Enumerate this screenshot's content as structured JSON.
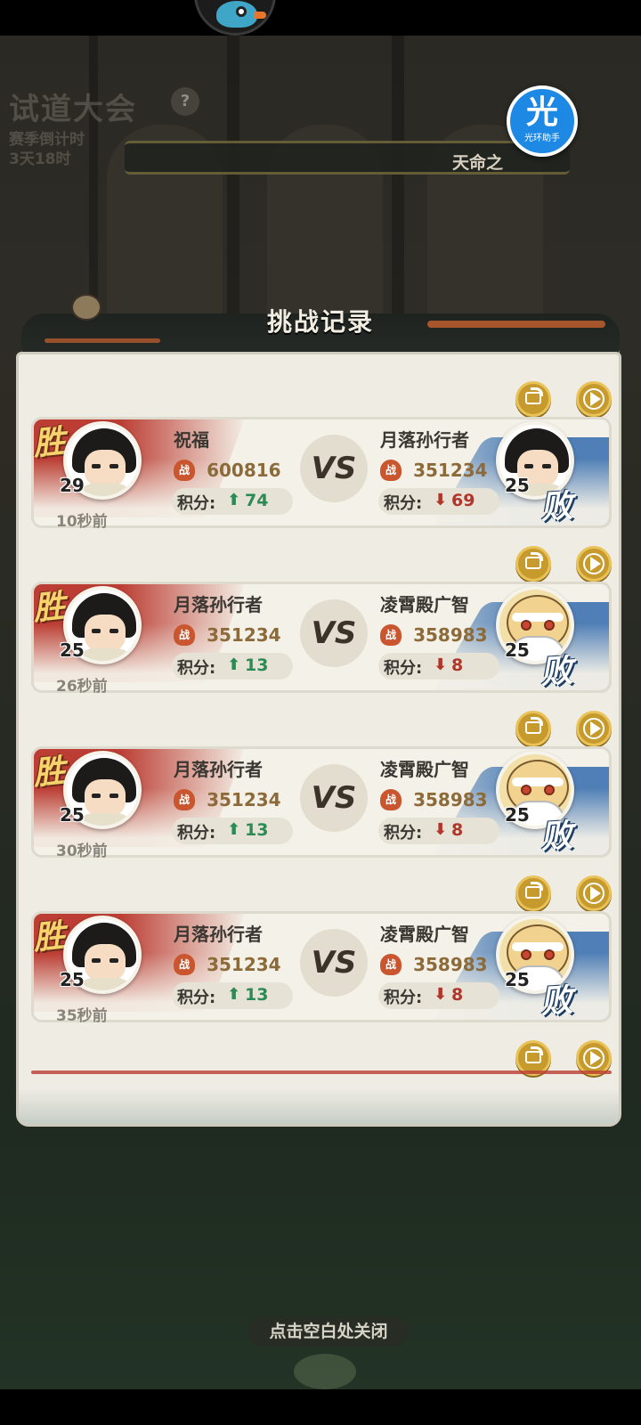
{
  "background": {
    "event_title": "试道大会",
    "help_glyph": "?",
    "season_line1": "赛季倒计时",
    "season_line2": "3天18时",
    "strip_text": "天命之"
  },
  "helper_badge": {
    "glyph": "光",
    "label": "光环助手"
  },
  "panel": {
    "title": "挑战记录"
  },
  "labels": {
    "vs": "VS",
    "score_label": "积分:",
    "win": "胜",
    "lose": "败",
    "power_icon_glyph": "战"
  },
  "colors": {
    "win": "#bb3d33",
    "lose": "#4f7fb6",
    "up": "#2c8a55",
    "down": "#b2352a",
    "gold": "#c79a2e"
  },
  "records": [
    {
      "time": "10秒前",
      "left": {
        "name": "祝福",
        "level": "29",
        "power": "600816",
        "score_arrow": "⬆",
        "score_change": "74",
        "avatar": "hero"
      },
      "right": {
        "name": "月落孙行者",
        "level": "25",
        "power": "351234",
        "score_arrow": "⬇",
        "score_change": "69",
        "avatar": "hero"
      }
    },
    {
      "time": "26秒前",
      "left": {
        "name": "月落孙行者",
        "level": "25",
        "power": "351234",
        "score_arrow": "⬆",
        "score_change": "13",
        "avatar": "hero"
      },
      "right": {
        "name": "凌霄殿广智",
        "level": "25",
        "power": "358983",
        "score_arrow": "⬇",
        "score_change": "8",
        "avatar": "monk"
      }
    },
    {
      "time": "30秒前",
      "left": {
        "name": "月落孙行者",
        "level": "25",
        "power": "351234",
        "score_arrow": "⬆",
        "score_change": "13",
        "avatar": "hero"
      },
      "right": {
        "name": "凌霄殿广智",
        "level": "25",
        "power": "358983",
        "score_arrow": "⬇",
        "score_change": "8",
        "avatar": "monk"
      }
    },
    {
      "time": "35秒前",
      "left": {
        "name": "月落孙行者",
        "level": "25",
        "power": "351234",
        "score_arrow": "⬆",
        "score_change": "13",
        "avatar": "hero"
      },
      "right": {
        "name": "凌霄殿广智",
        "level": "25",
        "power": "358983",
        "score_arrow": "⬇",
        "score_change": "8",
        "avatar": "monk"
      }
    }
  ],
  "close_hint": "点击空白处关闭"
}
